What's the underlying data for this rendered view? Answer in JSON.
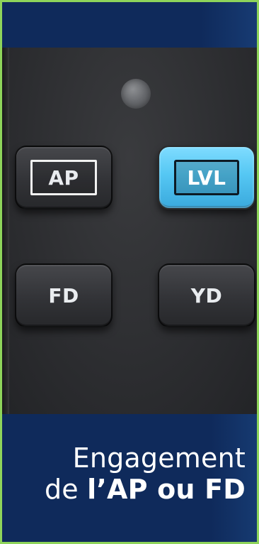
{
  "panel": {
    "buttons": {
      "ap": "AP",
      "lvl": "LVL",
      "fd": "FD",
      "yd": "YD"
    },
    "lvl_active": true,
    "accent_colors": {
      "frame_border": "#8ed45a",
      "lvl_button": "#55c7f3",
      "caption_bg": "#0f2a5b"
    }
  },
  "caption": {
    "line1": "Engagement",
    "line2_prefix": "de ",
    "line2_bold": "l’AP ou FD"
  }
}
